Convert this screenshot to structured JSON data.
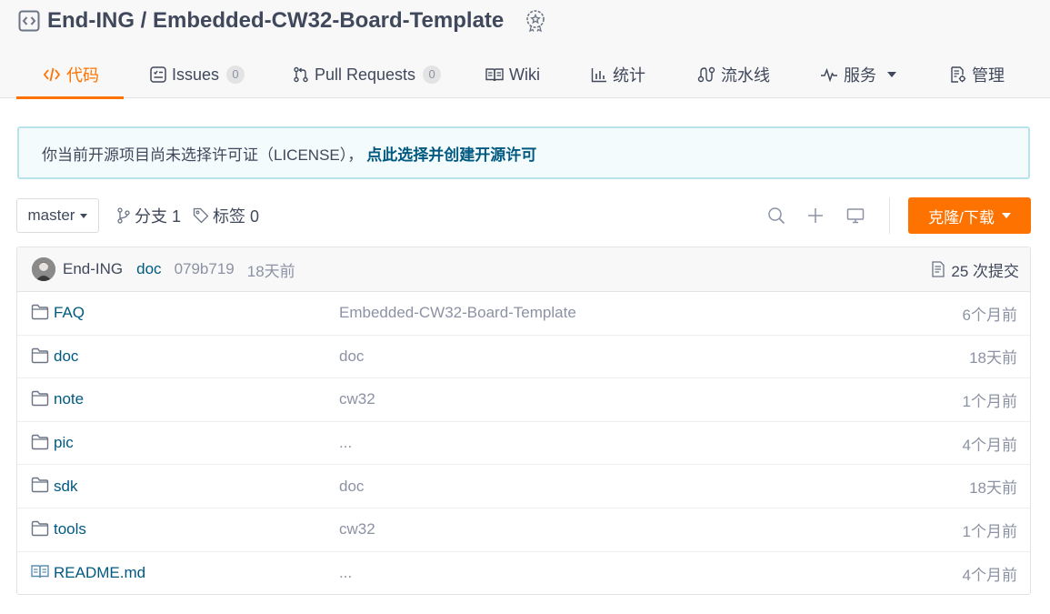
{
  "repo": {
    "title": "End-ING / Embedded-CW32-Board-Template"
  },
  "tabs": [
    {
      "label": "代码",
      "icon": "code-icon",
      "active": true
    },
    {
      "label": "Issues",
      "icon": "issues-icon",
      "count": "0"
    },
    {
      "label": "Pull Requests",
      "icon": "pull-request-icon",
      "count": "0"
    },
    {
      "label": "Wiki",
      "icon": "wiki-book-icon"
    },
    {
      "label": "统计",
      "icon": "bar-chart-icon"
    },
    {
      "label": "流水线",
      "icon": "pipeline-icon"
    },
    {
      "label": "服务",
      "icon": "pulse-icon",
      "dropdown": true
    },
    {
      "label": "管理",
      "icon": "settings-doc-icon"
    }
  ],
  "notice": {
    "text": "你当前开源项目尚未选择许可证（LICENSE），",
    "link": "点此选择并创建开源许可"
  },
  "toolbar": {
    "branch": "master",
    "branches_label": "分支 1",
    "tags_label": "标签 0",
    "clone_label": "克隆/下载"
  },
  "last_commit": {
    "author": "End-ING",
    "message": "doc",
    "sha": "079b719",
    "time": "18天前",
    "count_label": "25 次提交"
  },
  "files": [
    {
      "name": "FAQ",
      "type": "folder",
      "commit": "Embedded-CW32-Board-Template",
      "time": "6个月前"
    },
    {
      "name": "doc",
      "type": "folder",
      "commit": "doc",
      "time": "18天前"
    },
    {
      "name": "note",
      "type": "folder",
      "commit": "cw32",
      "time": "1个月前"
    },
    {
      "name": "pic",
      "type": "folder",
      "commit": "...",
      "time": "4个月前"
    },
    {
      "name": "sdk",
      "type": "folder",
      "commit": "doc",
      "time": "18天前"
    },
    {
      "name": "tools",
      "type": "folder",
      "commit": "cw32",
      "time": "1个月前"
    },
    {
      "name": "README.md",
      "type": "readme",
      "commit": "...",
      "time": "4个月前"
    }
  ],
  "colors": {
    "accent": "#fe7300",
    "link": "#005980",
    "text": "#40485b",
    "muted": "#8c92a4",
    "notice_bg": "#f3fbfd",
    "notice_border": "#b7e4ea"
  }
}
